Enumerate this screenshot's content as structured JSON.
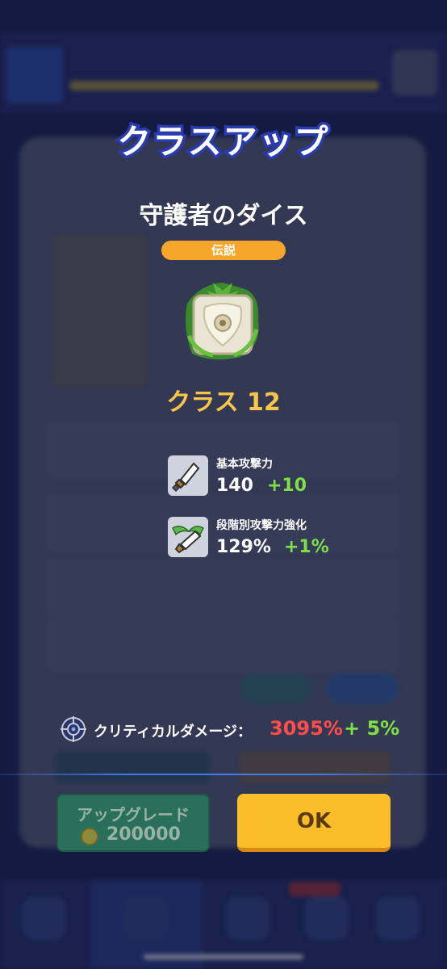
{
  "modal": {
    "title": "クラスアップ",
    "dice_name": "守護者のダイス",
    "rarity": "伝説",
    "class_label": "クラス 12"
  },
  "stats": [
    {
      "label": "基本攻撃力",
      "value": "140",
      "bonus": "+10",
      "icon": "sword-icon"
    },
    {
      "label": "段階別攻撃力強化",
      "value": "129%",
      "bonus": "+1%",
      "icon": "winged-sword-icon"
    }
  ],
  "crit": {
    "label": "クリティカルダメージ：",
    "value": "3095%",
    "bonus": "+ 5%",
    "icon": "crosshair-icon"
  },
  "buttons": {
    "upgrade_label": "アップグレード",
    "upgrade_cost": "200000",
    "ok_label": "OK"
  },
  "colors": {
    "title_outline": "#2a3bb0",
    "rarity": "#f7a62b",
    "class_label": "#f8c64a",
    "bonus_green": "#7ee047",
    "crit_red": "#ff4d4d",
    "ok_button": "#fbbe2a",
    "upgrade_button": "#2a6f5a"
  }
}
